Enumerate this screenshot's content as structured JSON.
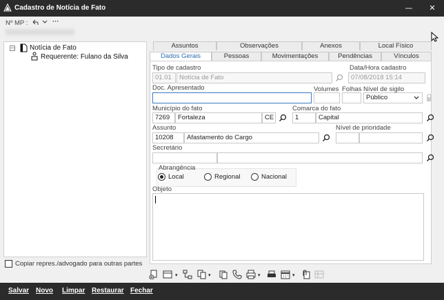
{
  "window": {
    "title": "Cadastro de Notícia de Fato",
    "minimize": "—",
    "close": "✕"
  },
  "toolbar": {
    "mp_label": "Nº MP :",
    "more": "···"
  },
  "tree": {
    "root": "Notícia de Fato",
    "child": "Requerente: Fulano da Silva",
    "copy_checkbox_label": "Copiar repres./advogado para outras partes"
  },
  "tabs_top": [
    "Assuntos",
    "Observações",
    "Anexos",
    "Local Físico"
  ],
  "tabs_bottom": [
    "Dados Gerais",
    "Pessoas",
    "Movimentações",
    "Pendências",
    "Vínculos"
  ],
  "form": {
    "tipo_label": "Tipo de cadastro",
    "tipo_code": "01.01",
    "tipo_value": "Notícia de Fato",
    "datahora_label": "Data/Hora cadastro",
    "datahora_value": "07/08/2018 15:14",
    "doc_label": "Doc. Apresentado",
    "volumes_label": "Volumes",
    "folhas_label": "Folhas",
    "sigilo_label": "Nível de sigilo",
    "sigilo_value": "Público",
    "municipio_label": "Município do fato",
    "municipio_code": "7269",
    "municipio_name": "Fortaleza",
    "municipio_uf": "CE",
    "comarca_label": "Comarca do fato",
    "comarca_code": "1",
    "comarca_name": "Capital",
    "assunto_label": "Assunto",
    "assunto_code": "10208",
    "assunto_name": "Afastamento do Cargo",
    "prioridade_label": "Nível de prioridade",
    "secretario_label": "Secretário",
    "abrangencia_label": "Abrangência",
    "abrangencia_options": [
      "Local",
      "Regional",
      "Nacional"
    ],
    "abrangencia_selected": "Local",
    "objeto_label": "Objeto"
  },
  "bottom": {
    "salvar": "Salvar",
    "novo": "Novo",
    "limpar": "Limpar",
    "restaurar": "Restaurar",
    "fechar": "Fechar"
  },
  "colors": {
    "titlebar": "#2b2b2b",
    "active_tab": "#2c6fb2",
    "focus_border": "#3b78c4"
  },
  "icons": [
    "app-icon",
    "undo-icon",
    "chevron-down-icon",
    "search-icon",
    "lock-icon",
    "document-icon",
    "person-icon",
    "print-icon",
    "calendar-icon",
    "attach-icon",
    "phone-icon"
  ]
}
